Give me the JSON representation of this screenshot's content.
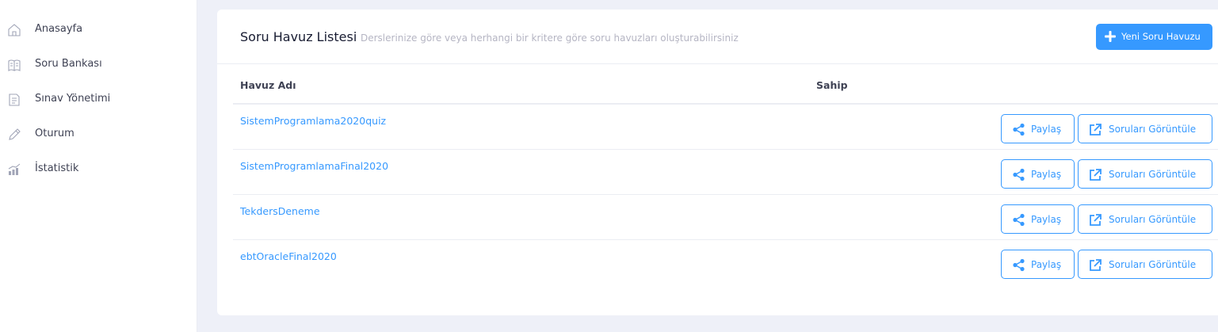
{
  "sidebar": {
    "items": [
      {
        "label": "Anasayfa",
        "icon": "home-icon"
      },
      {
        "label": "Soru Bankası",
        "icon": "question-bank-icon"
      },
      {
        "label": "Sınav Yönetimi",
        "icon": "exam-document-icon"
      },
      {
        "label": "Oturum",
        "icon": "pencil-icon"
      },
      {
        "label": "İstatistik",
        "icon": "statistics-chart-icon"
      }
    ]
  },
  "card": {
    "title": "Soru Havuz Listesi",
    "subtitle": "Derslerinize göre veya herhangi bir kritere göre soru havuzları oluşturabilirsiniz",
    "new_button_label": "Yeni Soru Havuzu"
  },
  "table": {
    "columns": [
      "Havuz Adı",
      "Sahip"
    ],
    "rows": [
      {
        "name": "SistemProgramlama2020quiz",
        "owner": ""
      },
      {
        "name": "SistemProgramlamaFinal2020",
        "owner": ""
      },
      {
        "name": "TekdersDeneme",
        "owner": ""
      },
      {
        "name": "ebtOracleFinal2020",
        "owner": ""
      }
    ],
    "share_label": "Paylaş",
    "view_label": "Soruları Görüntüle"
  },
  "colors": {
    "accent": "#3699ff",
    "background": "#eef0f8",
    "muted_text": "#b5b5c3"
  }
}
